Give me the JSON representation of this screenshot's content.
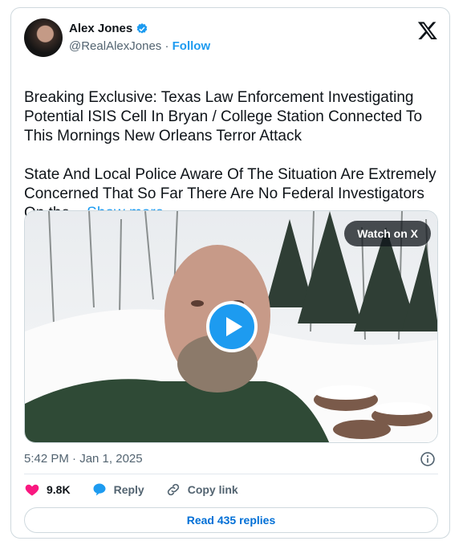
{
  "author": {
    "name": "Alex Jones",
    "handle": "@RealAlexJones",
    "separator": "·",
    "follow_label": "Follow",
    "verified_color": "#1d9bf0"
  },
  "tweet": {
    "paragraph1": "Breaking Exclusive: Texas Law Enforcement Investigating Potential ISIS Cell In Bryan / College Station Connected To This Mornings New Orleans Terror Attack",
    "paragraph2": "State And Local Police Aware Of The Situation Are Extremely Concerned That So Far There Are No Federal Investigators On the...",
    "show_more": "Show more",
    "timestamp": "5:42 PM · Jan 1, 2025"
  },
  "media": {
    "watch_label": "Watch on X",
    "play_icon": "play-icon"
  },
  "actions": {
    "likes": "9.8K",
    "reply_label": "Reply",
    "copy_label": "Copy link",
    "read_replies": "Read 435 replies"
  },
  "colors": {
    "accent": "#1d9bf0",
    "like": "#f91880",
    "muted": "#536471"
  }
}
